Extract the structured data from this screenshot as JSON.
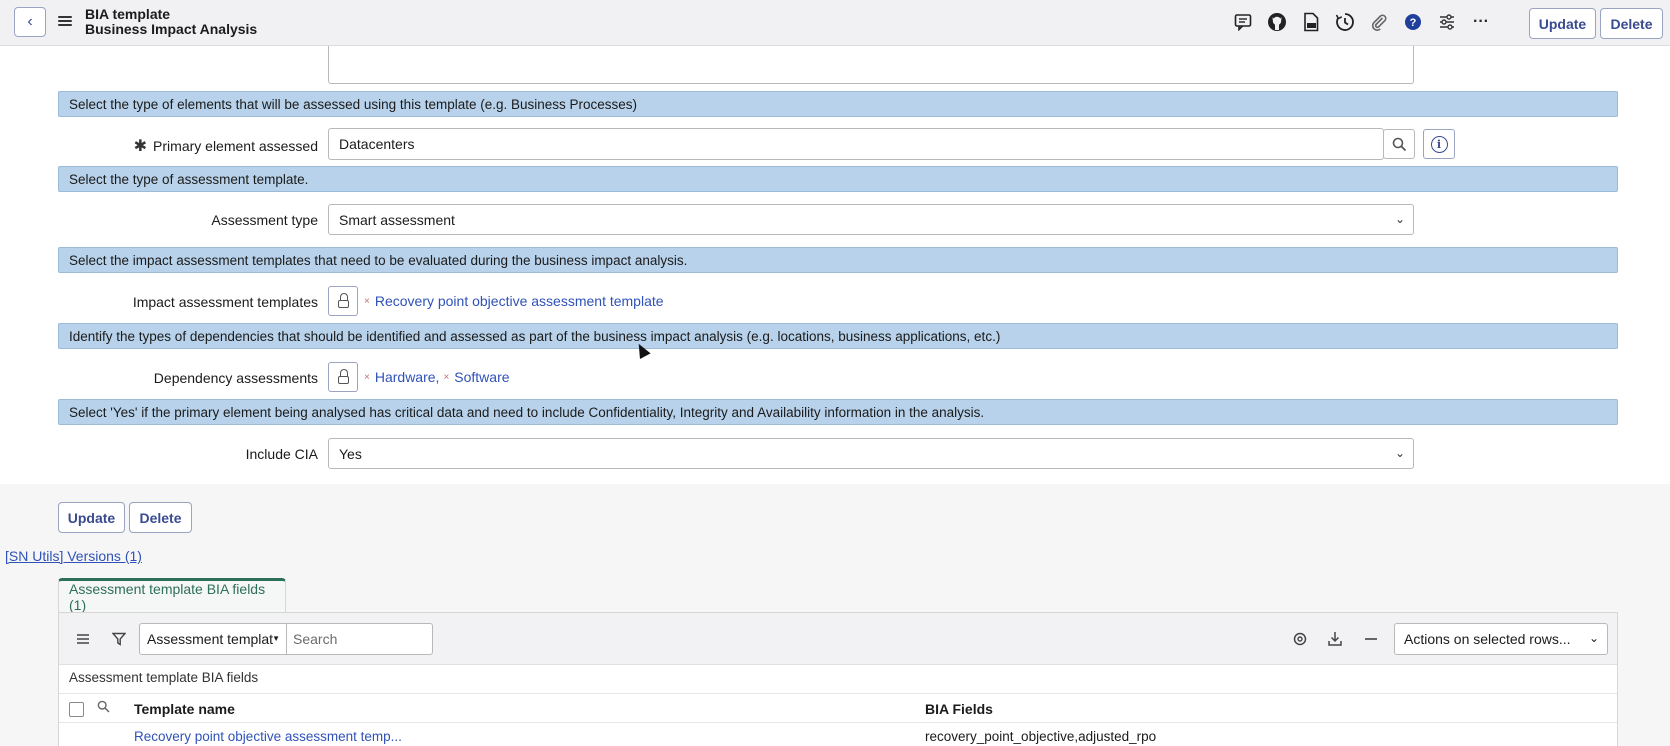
{
  "header": {
    "title_line1": "BIA template",
    "title_line2": "Business Impact Analysis",
    "icons": [
      "comment-icon",
      "github-icon",
      "document-icon",
      "history-icon",
      "attachment-icon",
      "help-icon",
      "settings-sliders-icon",
      "more-icon"
    ],
    "update_label": "Update",
    "delete_label": "Delete"
  },
  "form": {
    "sections": [
      {
        "text": "Select the type of elements that will be assessed using this template (e.g. Business Processes)"
      },
      {
        "text": "Select the type of assessment template."
      },
      {
        "text": "Select the impact assessment templates that need to be evaluated during the business impact analysis."
      },
      {
        "text": "Identify the types of dependencies that should be identified and assessed as part of the business impact analysis (e.g. locations, business applications, etc.)"
      },
      {
        "text": "Select 'Yes' if the primary element being analysed has critical data and need to include Confidentiality, Integrity and Availability information in the analysis."
      }
    ],
    "primary_element": {
      "label": "Primary element assessed",
      "value": "Datacenters"
    },
    "assessment_type": {
      "label": "Assessment type",
      "value": "Smart assessment"
    },
    "impact_templates": {
      "label": "Impact assessment templates",
      "items": [
        "Recovery point objective assessment template"
      ]
    },
    "dependency_assessments": {
      "label": "Dependency assessments",
      "items": [
        "Hardware",
        "Software"
      ]
    },
    "include_cia": {
      "label": "Include CIA",
      "value": "Yes"
    },
    "update_label": "Update",
    "delete_label": "Delete"
  },
  "sn_utils_link": "[SN Utils] Versions (1)",
  "related_list": {
    "tab_label": "Assessment template BIA fields (1)",
    "field_select": "Assessment templat",
    "search_placeholder": "Search",
    "actions_select": "Actions on selected rows...",
    "title": "Assessment template BIA fields",
    "columns": [
      "Template name",
      "BIA Fields"
    ],
    "rows": [
      {
        "template_name": "Recovery point objective assessment temp...",
        "bia_fields": "recovery_point_objective,adjusted_rpo"
      }
    ]
  }
}
